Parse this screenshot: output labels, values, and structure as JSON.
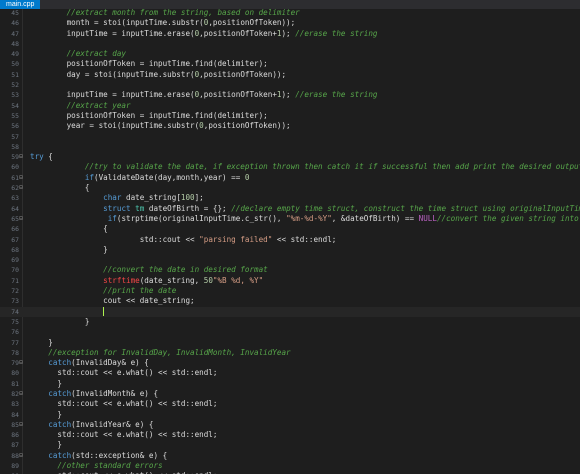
{
  "tab": {
    "label": "main.cpp"
  },
  "colors": {
    "background": "#1e1e1e",
    "keyword": "#569cd6",
    "comment": "#57a64a",
    "string": "#d69d85",
    "number": "#b5cea8",
    "type": "#4ec9b0",
    "macro": "#bd63c5"
  },
  "editor": {
    "lines": [
      {
        "n": "45",
        "fold": "",
        "tokens": [
          [
            "cm",
            "        //extract month from the string, based on delimiter"
          ]
        ]
      },
      {
        "n": "46",
        "fold": "",
        "tokens": [
          [
            "",
            "        month = stoi(inputTime.substr("
          ],
          [
            "num",
            "0"
          ],
          [
            "",
            ",positionOfToken));"
          ]
        ]
      },
      {
        "n": "47",
        "fold": "",
        "tokens": [
          [
            "",
            "        inputTime = inputTime.erase("
          ],
          [
            "num",
            "0"
          ],
          [
            "",
            ",positionOfToken+"
          ],
          [
            "num",
            "1"
          ],
          [
            "",
            "); "
          ],
          [
            "cm",
            "//erase the string"
          ]
        ]
      },
      {
        "n": "48",
        "fold": "",
        "tokens": []
      },
      {
        "n": "49",
        "fold": "",
        "tokens": [
          [
            "cm",
            "        //extract day"
          ]
        ]
      },
      {
        "n": "50",
        "fold": "",
        "tokens": [
          [
            "",
            "        positionOfToken = inputTime.find(delimiter);"
          ]
        ]
      },
      {
        "n": "51",
        "fold": "",
        "tokens": [
          [
            "",
            "        day = stoi(inputTime.substr("
          ],
          [
            "num",
            "0"
          ],
          [
            "",
            ",positionOfToken));"
          ]
        ]
      },
      {
        "n": "52",
        "fold": "",
        "tokens": []
      },
      {
        "n": "53",
        "fold": "",
        "tokens": [
          [
            "",
            "        inputTime = inputTime.erase("
          ],
          [
            "num",
            "0"
          ],
          [
            "",
            ",positionOfToken+"
          ],
          [
            "num",
            "1"
          ],
          [
            "",
            "); "
          ],
          [
            "cm",
            "//erase the string"
          ]
        ]
      },
      {
        "n": "54",
        "fold": "",
        "tokens": [
          [
            "cm",
            "        //extract year"
          ]
        ]
      },
      {
        "n": "55",
        "fold": "",
        "tokens": [
          [
            "",
            "        positionOfToken = inputTime.find(delimiter);"
          ]
        ]
      },
      {
        "n": "56",
        "fold": "",
        "tokens": [
          [
            "",
            "        year = stoi(inputTime.substr("
          ],
          [
            "num",
            "0"
          ],
          [
            "",
            ",positionOfToken));"
          ]
        ]
      },
      {
        "n": "57",
        "fold": "",
        "tokens": []
      },
      {
        "n": "58",
        "fold": "",
        "tokens": []
      },
      {
        "n": "59",
        "fold": "-",
        "tokens": [
          [
            "kw",
            "try"
          ],
          [
            "",
            " {"
          ]
        ]
      },
      {
        "n": "60",
        "fold": "",
        "tokens": [
          [
            "cm",
            "            //try to validate the date, if exception thrown then catch it if successful then add print the desired output"
          ]
        ]
      },
      {
        "n": "61",
        "fold": "-",
        "tokens": [
          [
            "",
            "            "
          ],
          [
            "kw",
            "if"
          ],
          [
            "",
            "(ValidateDate(day,month,year) == "
          ],
          [
            "num",
            "0"
          ],
          [
            ")"
          ]
        ]
      },
      {
        "n": "62",
        "fold": "-",
        "tokens": [
          [
            "",
            "            {"
          ]
        ]
      },
      {
        "n": "63",
        "fold": "",
        "tokens": [
          [
            "",
            "                "
          ],
          [
            "kw",
            "char"
          ],
          [
            "",
            " date_string["
          ],
          [
            "num",
            "100"
          ],
          [
            "",
            "];"
          ]
        ]
      },
      {
        "n": "64",
        "fold": "",
        "tokens": [
          [
            "",
            "                "
          ],
          [
            "kw",
            "struct"
          ],
          [
            "",
            " "
          ],
          [
            "ty",
            "tm"
          ],
          [
            "",
            " dateOfBirth = {}; "
          ],
          [
            "cm",
            "//declare empty time struct, construct the time struct using originalInputTime"
          ]
        ]
      },
      {
        "n": "65",
        "fold": "-",
        "tokens": [
          [
            "",
            "                 "
          ],
          [
            "kw",
            "if"
          ],
          [
            "",
            "(strptime(originalInputTime.c_str(), "
          ],
          [
            "str",
            "\"%m-%d-%Y\""
          ],
          [
            "",
            ", &dateOfBirth) == "
          ],
          [
            "mac",
            "NULL"
          ],
          [
            ") "
          ],
          [
            "cm",
            "//convert the given string into"
          ]
        ]
      },
      {
        "n": "66",
        "fold": "",
        "tokens": [
          [
            "",
            "                {"
          ]
        ]
      },
      {
        "n": "67",
        "fold": "",
        "tokens": [
          [
            "",
            "                        std::cout << "
          ],
          [
            "str",
            "\"parsing failed\""
          ],
          [
            "",
            " << std::endl;"
          ]
        ]
      },
      {
        "n": "68",
        "fold": "",
        "tokens": [
          [
            "",
            "                }"
          ]
        ]
      },
      {
        "n": "69",
        "fold": "",
        "tokens": []
      },
      {
        "n": "70",
        "fold": "",
        "tokens": [
          [
            "cm",
            "                //convert the date in desired format"
          ]
        ]
      },
      {
        "n": "71",
        "fold": "",
        "tokens": [
          [
            "",
            "                "
          ],
          [
            "err",
            "strftime"
          ],
          [
            "",
            "(date_string, "
          ],
          [
            "num",
            "50"
          ],
          [
            ", "
          ],
          [
            "str",
            "\"%B %d, %Y\""
          ],
          [
            ", &dateOfBirth);"
          ]
        ]
      },
      {
        "n": "72",
        "fold": "",
        "tokens": [
          [
            "cm",
            "                //print the date"
          ]
        ]
      },
      {
        "n": "73",
        "fold": "",
        "tokens": [
          [
            "",
            "                cout << date_string;"
          ]
        ]
      },
      {
        "n": "74",
        "fold": "",
        "caret": true,
        "tokens": [
          [
            "",
            "                "
          ]
        ]
      },
      {
        "n": "75",
        "fold": "",
        "tokens": [
          [
            "",
            "            }"
          ]
        ]
      },
      {
        "n": "76",
        "fold": "",
        "tokens": []
      },
      {
        "n": "77",
        "fold": "",
        "tokens": [
          [
            "",
            "    }"
          ]
        ]
      },
      {
        "n": "78",
        "fold": "",
        "tokens": [
          [
            "cm",
            "    //exception for InvalidDay, InvalidMonth, InvalidYear"
          ]
        ]
      },
      {
        "n": "79",
        "fold": "-",
        "tokens": [
          [
            "",
            "    "
          ],
          [
            "kw",
            "catch"
          ],
          [
            "",
            "(InvalidDay& e) {"
          ]
        ]
      },
      {
        "n": "80",
        "fold": "",
        "tokens": [
          [
            "",
            "      std::cout << e.what() << std::endl;"
          ]
        ]
      },
      {
        "n": "81",
        "fold": "",
        "tokens": [
          [
            "",
            "      }"
          ]
        ]
      },
      {
        "n": "82",
        "fold": "-",
        "tokens": [
          [
            "",
            "    "
          ],
          [
            "kw",
            "catch"
          ],
          [
            "",
            "(InvalidMonth& e) {"
          ]
        ]
      },
      {
        "n": "83",
        "fold": "",
        "tokens": [
          [
            "",
            "      std::cout << e.what() << std::endl;"
          ]
        ]
      },
      {
        "n": "84",
        "fold": "",
        "tokens": [
          [
            "",
            "      }"
          ]
        ]
      },
      {
        "n": "85",
        "fold": "-",
        "tokens": [
          [
            "",
            "    "
          ],
          [
            "kw",
            "catch"
          ],
          [
            "",
            "(InvalidYear& e) {"
          ]
        ]
      },
      {
        "n": "86",
        "fold": "",
        "tokens": [
          [
            "",
            "      std::cout << e.what() << std::endl;"
          ]
        ]
      },
      {
        "n": "87",
        "fold": "",
        "tokens": [
          [
            "",
            "      }"
          ]
        ]
      },
      {
        "n": "88",
        "fold": "-",
        "tokens": [
          [
            "",
            "    "
          ],
          [
            "kw",
            "catch"
          ],
          [
            "",
            "(std::exception& e) {"
          ]
        ]
      },
      {
        "n": "89",
        "fold": "",
        "tokens": [
          [
            "cm",
            "      //other standard errors"
          ]
        ]
      },
      {
        "n": "90",
        "fold": "",
        "tokens": [
          [
            "",
            "      std::cout << e.what() << std::endl;"
          ]
        ]
      }
    ]
  }
}
